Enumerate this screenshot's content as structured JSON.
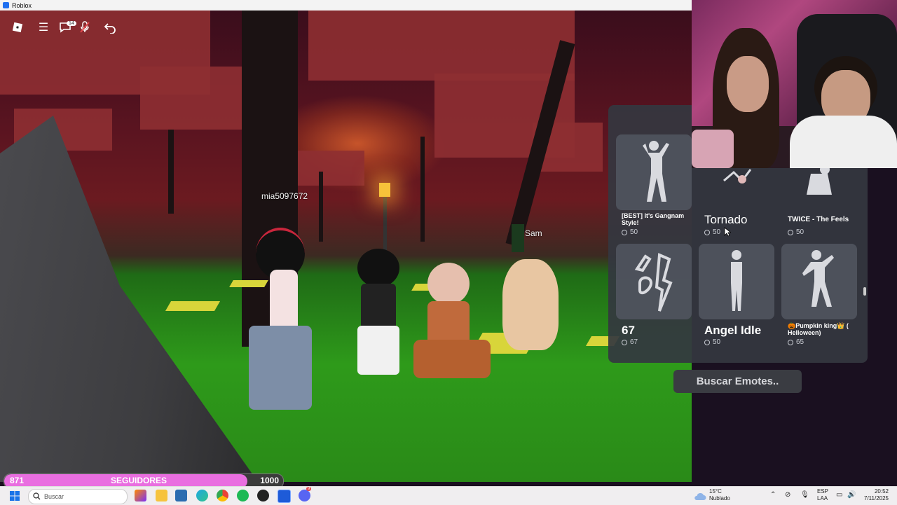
{
  "window": {
    "title": "Roblox"
  },
  "game": {
    "nametags": {
      "player1": "mia5097672",
      "player2": "Sam"
    },
    "chat_badge": "14"
  },
  "emotes": [
    {
      "name": "[BEST] It's Gangnam Style!",
      "price": "50"
    },
    {
      "name": "Tornado",
      "price": "50"
    },
    {
      "name": "TWICE - The Feels",
      "price": "50"
    },
    {
      "name": "67",
      "price": "67"
    },
    {
      "name": "Angel Idle",
      "price": "50"
    },
    {
      "name": "🎃Pumpkin king👑 ( Helloween)",
      "price": "65"
    }
  ],
  "search_button": "Buscar Emotes..",
  "follower_goal": {
    "current": "871",
    "label": "SEGUIDORES",
    "target": "1000",
    "progress": 0.871
  },
  "taskbar": {
    "search_placeholder": "Buscar",
    "weather_temp": "15°C",
    "weather_desc": "Nublado",
    "lang_top": "ESP",
    "lang_bottom": "LAA",
    "time": "20:52",
    "date": "7/11/2025",
    "discord_badge": "9"
  },
  "colors": {
    "goal_fill": "#e96ee0",
    "panel": "#343740",
    "grass": "#2e9a1a"
  }
}
